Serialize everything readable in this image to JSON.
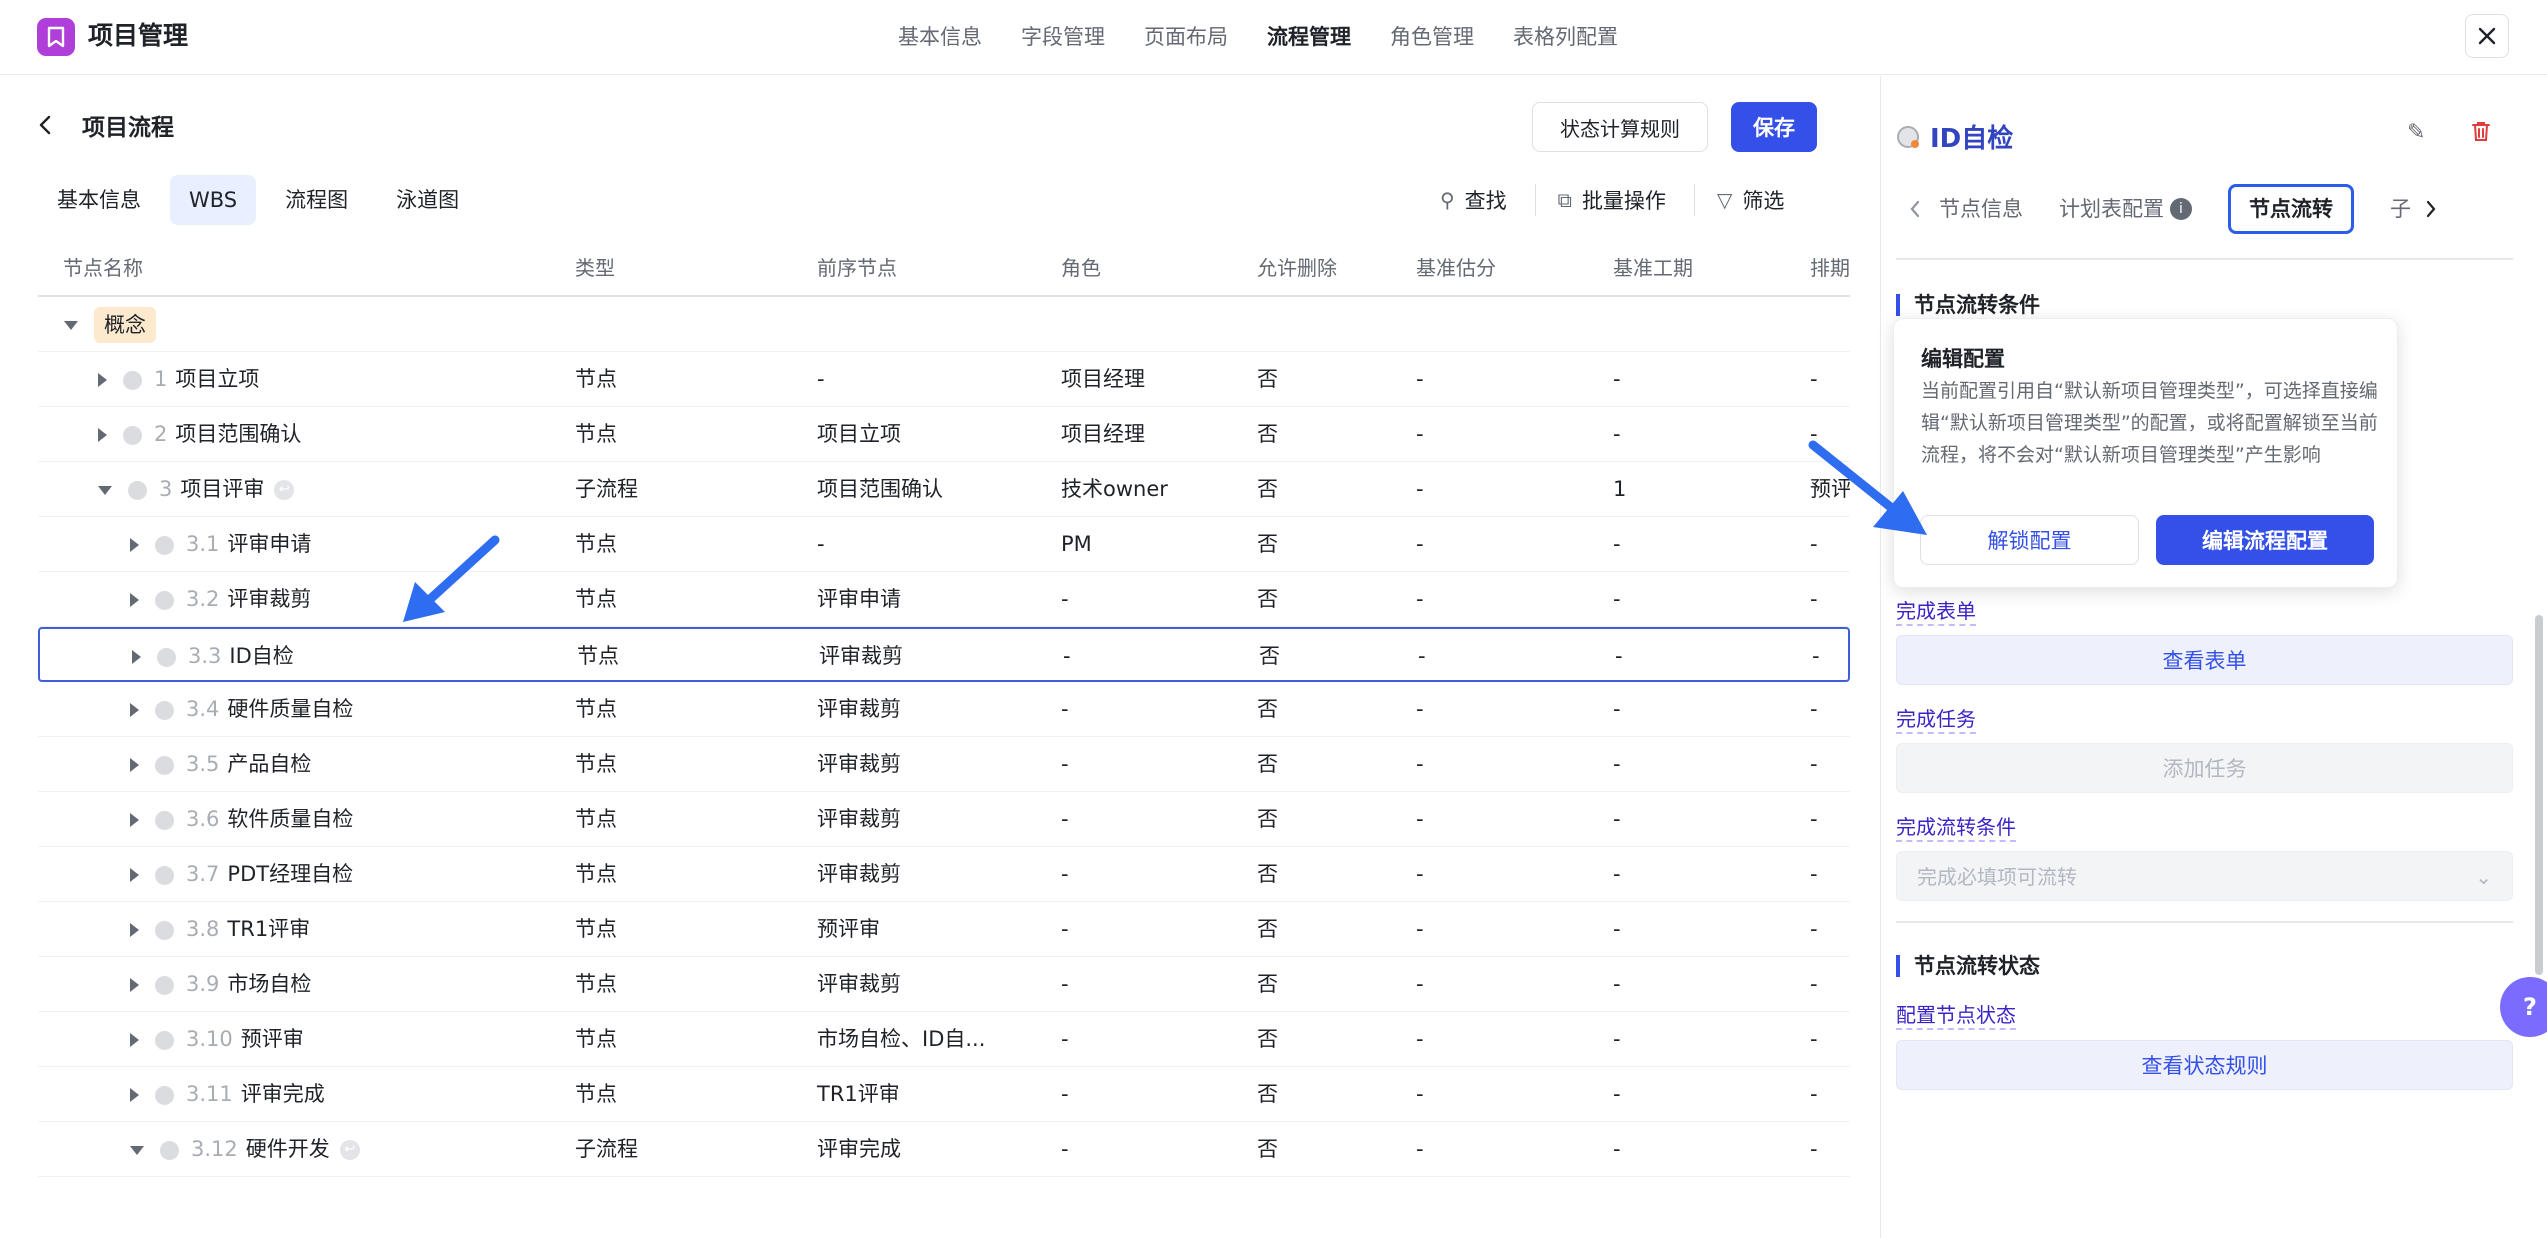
{
  "app": {
    "title": "项目管理"
  },
  "topnav": [
    "基本信息",
    "字段管理",
    "页面布局",
    "流程管理",
    "角色管理",
    "表格列配置"
  ],
  "page": {
    "title": "项目流程",
    "status_rule_btn": "状态计算规则",
    "save_btn": "保存"
  },
  "tabs": [
    "基本信息",
    "WBS",
    "流程图",
    "泳道图"
  ],
  "tools": {
    "find": "查找",
    "batch": "批量操作",
    "filter": "筛选"
  },
  "table": {
    "headers": [
      "节点名称",
      "类型",
      "前序节点",
      "角色",
      "允许删除",
      "基准估分",
      "基准工期",
      "排期"
    ],
    "group": "概念",
    "rows": [
      {
        "num": "1",
        "name": "项目立项",
        "type": "节点",
        "prev": "-",
        "role": "项目经理",
        "del": "否",
        "est": "-",
        "dur": "-",
        "sched": "-"
      },
      {
        "num": "2",
        "name": "项目范围确认",
        "type": "节点",
        "prev": "项目立项",
        "role": "项目经理",
        "del": "否",
        "est": "-",
        "dur": "-",
        "sched": "-"
      },
      {
        "num": "3",
        "name": "项目评审",
        "type": "子流程",
        "prev": "项目范围确认",
        "role": "技术owner",
        "del": "否",
        "est": "-",
        "dur": "1",
        "sched": "预评"
      },
      {
        "num": "3.1",
        "name": "评审申请",
        "type": "节点",
        "prev": "-",
        "role": "PM",
        "del": "否",
        "est": "-",
        "dur": "-",
        "sched": "-"
      },
      {
        "num": "3.2",
        "name": "评审裁剪",
        "type": "节点",
        "prev": "评审申请",
        "role": "-",
        "del": "否",
        "est": "-",
        "dur": "-",
        "sched": "-"
      },
      {
        "num": "3.3",
        "name": "ID自检",
        "type": "节点",
        "prev": "评审裁剪",
        "role": "-",
        "del": "否",
        "est": "-",
        "dur": "-",
        "sched": "-"
      },
      {
        "num": "3.4",
        "name": "硬件质量自检",
        "type": "节点",
        "prev": "评审裁剪",
        "role": "-",
        "del": "否",
        "est": "-",
        "dur": "-",
        "sched": "-"
      },
      {
        "num": "3.5",
        "name": "产品自检",
        "type": "节点",
        "prev": "评审裁剪",
        "role": "-",
        "del": "否",
        "est": "-",
        "dur": "-",
        "sched": "-"
      },
      {
        "num": "3.6",
        "name": "软件质量自检",
        "type": "节点",
        "prev": "评审裁剪",
        "role": "-",
        "del": "否",
        "est": "-",
        "dur": "-",
        "sched": "-"
      },
      {
        "num": "3.7",
        "name": "PDT经理自检",
        "type": "节点",
        "prev": "评审裁剪",
        "role": "-",
        "del": "否",
        "est": "-",
        "dur": "-",
        "sched": "-"
      },
      {
        "num": "3.8",
        "name": "TR1评审",
        "type": "节点",
        "prev": "预评审",
        "role": "-",
        "del": "否",
        "est": "-",
        "dur": "-",
        "sched": "-"
      },
      {
        "num": "3.9",
        "name": "市场自检",
        "type": "节点",
        "prev": "评审裁剪",
        "role": "-",
        "del": "否",
        "est": "-",
        "dur": "-",
        "sched": "-"
      },
      {
        "num": "3.10",
        "name": "预评审",
        "type": "节点",
        "prev": "市场自检、ID自...",
        "role": "-",
        "del": "否",
        "est": "-",
        "dur": "-",
        "sched": "-"
      },
      {
        "num": "3.11",
        "name": "评审完成",
        "type": "节点",
        "prev": "TR1评审",
        "role": "-",
        "del": "否",
        "est": "-",
        "dur": "-",
        "sched": "-"
      },
      {
        "num": "3.12",
        "name": "硬件开发",
        "type": "子流程",
        "prev": "评审完成",
        "role": "-",
        "del": "否",
        "est": "-",
        "dur": "-",
        "sched": "-"
      }
    ]
  },
  "panel": {
    "title": "ID自检",
    "tabs": [
      "节点信息",
      "计划表配置",
      "节点流转",
      "子"
    ],
    "section1": "节点流转条件",
    "complete_form": "完成表单",
    "view_form": "查看表单",
    "complete_task": "完成任务",
    "add_task": "添加任务",
    "complete_cond": "完成流转条件",
    "cond_select": "完成必填项可流转",
    "section2": "节点流转状态",
    "config_status": "配置节点状态",
    "view_rules": "查看状态规则"
  },
  "popover": {
    "title": "编辑配置",
    "body": "当前配置引用自“默认新项目管理类型”，可选择直接编辑“默认新项目管理类型”的配置，或将配置解锁至当前流程，将不会对“默认新项目管理类型”产生影响",
    "unlock": "解锁配置",
    "edit": "编辑流程配置"
  },
  "colors": {
    "primary": "#3450e8",
    "logo": "#b03ed8",
    "tag": "#fde9cd",
    "arrow": "#2f6df0"
  }
}
